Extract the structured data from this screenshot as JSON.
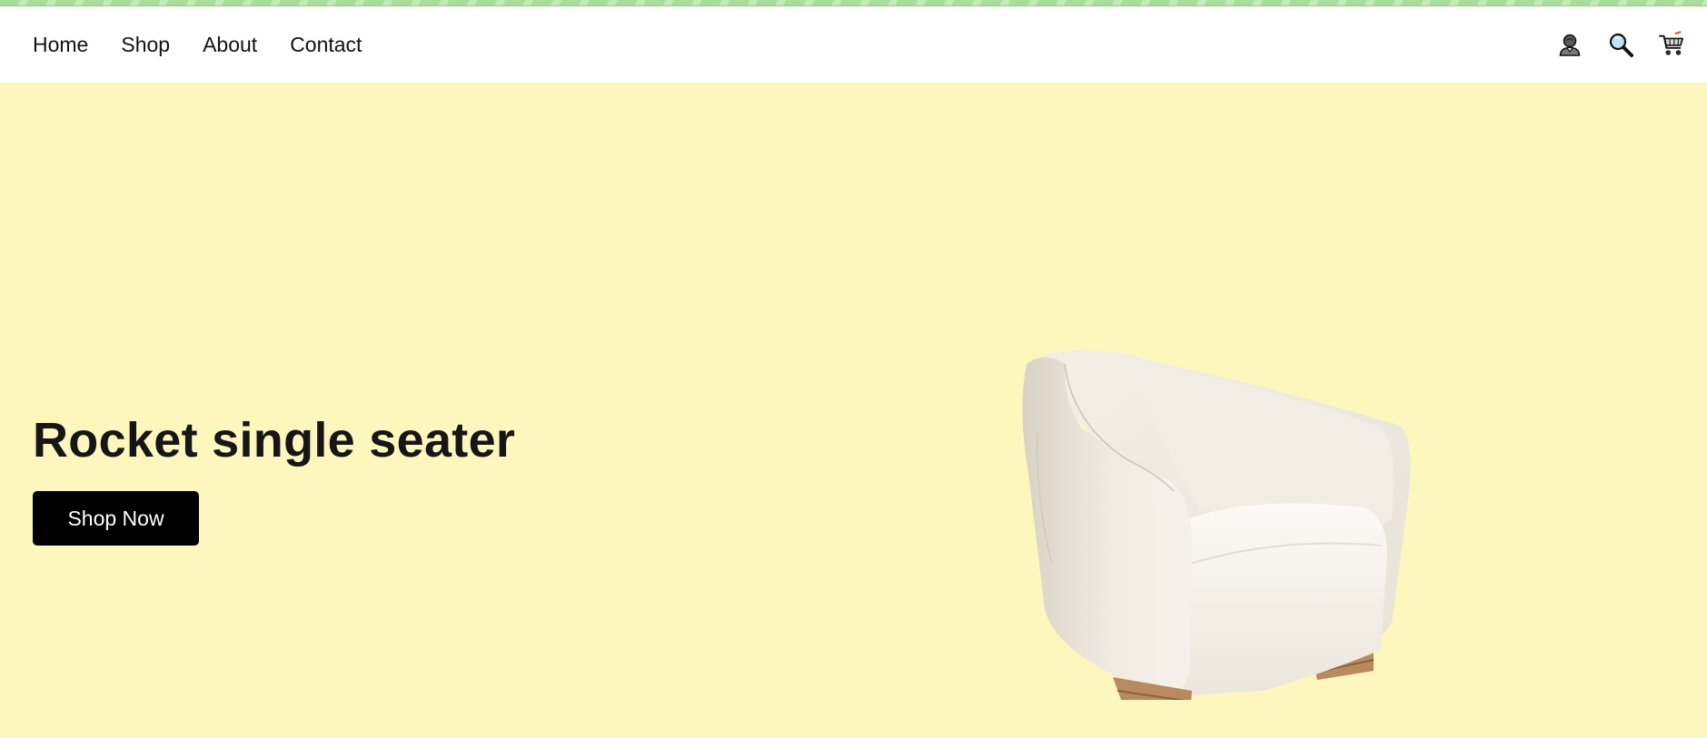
{
  "nav": {
    "links": [
      "Home",
      "Shop",
      "About",
      "Contact"
    ],
    "icons": [
      "user-icon",
      "search-icon",
      "cart-icon"
    ]
  },
  "hero": {
    "title": "Rocket single seater",
    "cta_label": "Shop Now",
    "background_color": "#fdf7bd",
    "image": "white armchair with wooden legs"
  },
  "colors": {
    "top_strip": "#a8dd9a",
    "navbar": "#ffffff",
    "button": "#000000",
    "button_text": "#ffffff"
  }
}
